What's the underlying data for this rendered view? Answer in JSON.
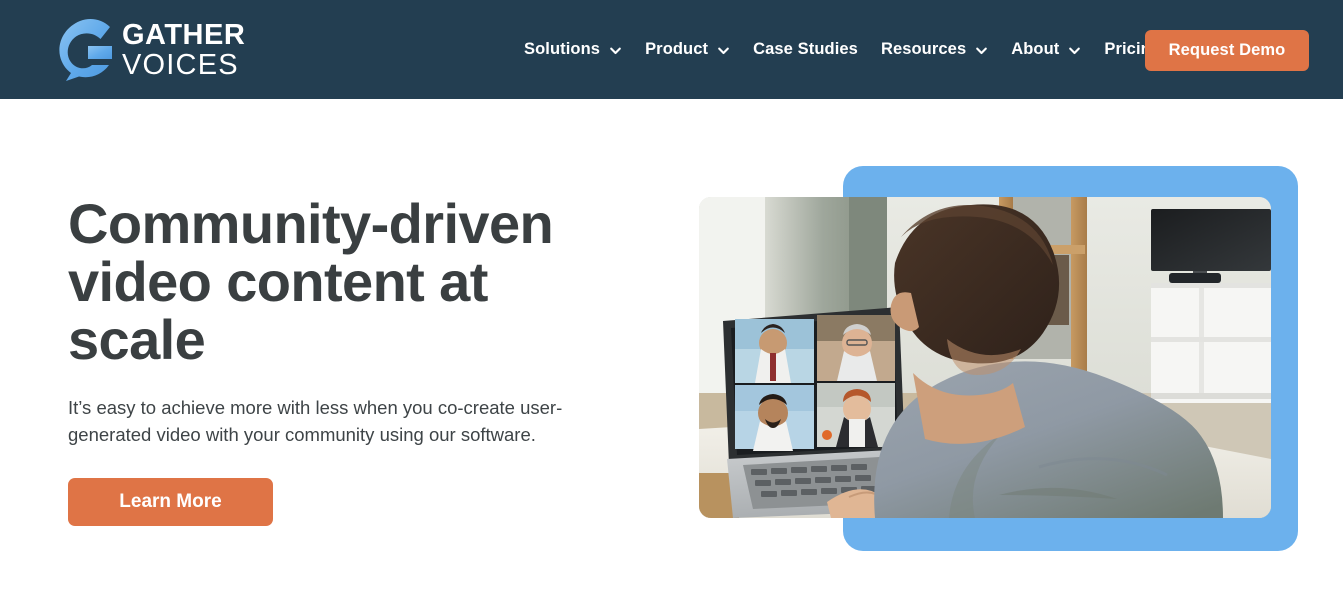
{
  "header": {
    "background_color": "#233E51",
    "logo": {
      "icon": "gather-voices-g-bubble-logo",
      "line1": "GATHER",
      "line2": "VOICES",
      "mark_color": "#6CB1ED"
    },
    "nav_items": [
      {
        "label": "Solutions",
        "has_dropdown": true,
        "icon": "chevron-down-icon"
      },
      {
        "label": "Product",
        "has_dropdown": true,
        "icon": "chevron-down-icon"
      },
      {
        "label": "Case Studies",
        "has_dropdown": false,
        "icon": ""
      },
      {
        "label": "Resources",
        "has_dropdown": true,
        "icon": "chevron-down-icon"
      },
      {
        "label": "About",
        "has_dropdown": true,
        "icon": "chevron-down-icon"
      },
      {
        "label": "Pricing",
        "has_dropdown": false,
        "icon": ""
      }
    ],
    "cta": {
      "label": "Request Demo",
      "color": "#DF7446",
      "text_color": "#FFFFFF"
    }
  },
  "hero": {
    "title": "Community-driven video content at scale",
    "title_color": "#3A3F41",
    "subtitle": "It’s easy to achieve more with less when you co-create user-generated video with your community using our software.",
    "subtitle_color": "#3E4447",
    "cta": {
      "label": "Learn More",
      "color": "#DF7446",
      "text_color": "#FFFFFF"
    },
    "media": {
      "accent_card_color": "#6CB1ED",
      "photo_alt": "Man in gray t-shirt seen from behind sitting at a white desk on a laptop video call with four participants on screen, living room with TV and shelving in the background"
    }
  },
  "page": {
    "background_color": "#FFFFFF"
  }
}
